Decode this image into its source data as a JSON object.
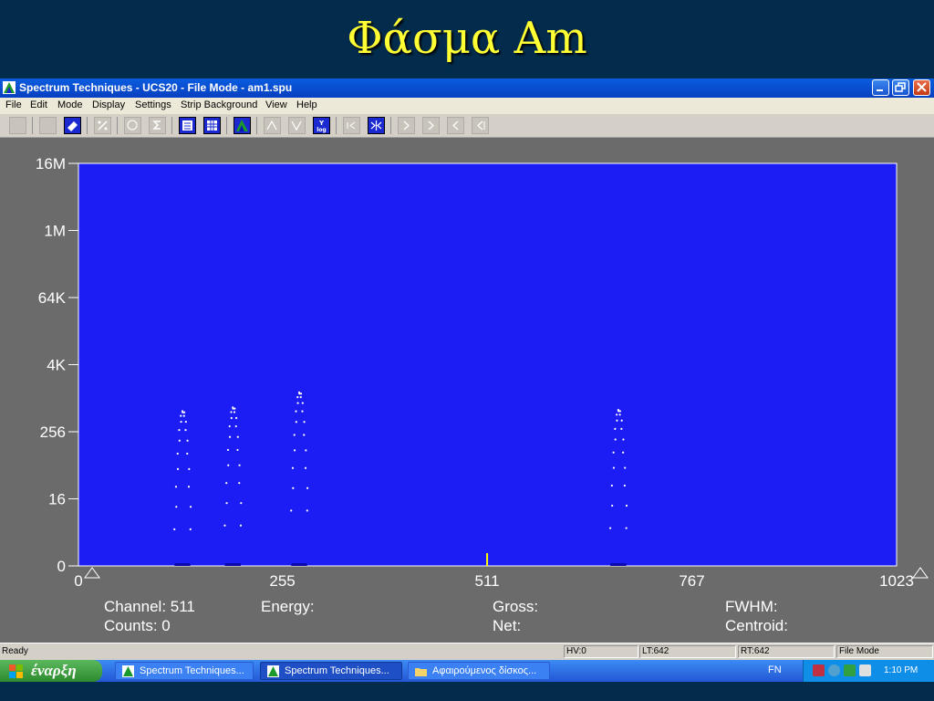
{
  "slide": {
    "title": "Φάσμα Am"
  },
  "window": {
    "title": "Spectrum Techniques - UCS20 - File Mode - am1.spu"
  },
  "menu": [
    "File",
    "Edit",
    "Mode",
    "Display",
    "Settings",
    "Strip Background",
    "View",
    "Help"
  ],
  "readout": {
    "channel": "Channel: 511",
    "counts": "Counts: 0",
    "energy": "Energy:",
    "gross": "Gross:",
    "net": "Net:",
    "fwhm": "FWHM:",
    "centroid": "Centroid:"
  },
  "status": {
    "ready": "Ready",
    "hv": "HV:0",
    "lt": "LT:642",
    "rt": "RT:642",
    "mode": "File Mode"
  },
  "taskbar": {
    "start": "έναρξη",
    "tasks": [
      "Spectrum Techniques...",
      "Spectrum Techniques...",
      "Αφαιρούμενος δίσκος..."
    ],
    "lang": "FN",
    "clock": "1:10 PM"
  },
  "colors": {
    "plot_bg": "#1c1cf4",
    "data_points": "#ffffff",
    "cursor": "#ffff00",
    "frame": "#6b6b6b"
  },
  "chart_data": {
    "type": "scatter",
    "xlim": [
      0,
      1023
    ],
    "yscale": "log",
    "x_ticks": [
      "0",
      "255",
      "511",
      "767",
      "1023"
    ],
    "y_ticks": [
      "0",
      "16",
      "256",
      "4K",
      "64K",
      "1M",
      "16M"
    ],
    "cursor_channel": 511,
    "peaks": [
      {
        "center": 130,
        "height": 600
      },
      {
        "center": 193,
        "height": 700
      },
      {
        "center": 276,
        "height": 1300
      },
      {
        "center": 675,
        "height": 630
      }
    ]
  }
}
